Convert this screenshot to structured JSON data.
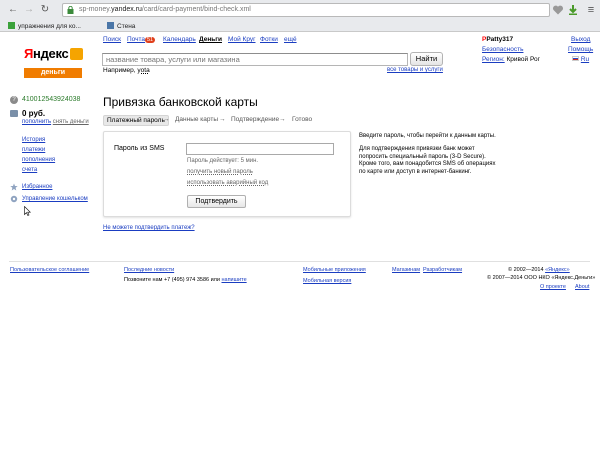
{
  "browser": {
    "url_prefix": "sp-money.",
    "url_domain": "yandex.ru",
    "url_path": "/card/card-payment/bind-check.xml",
    "bookmarks": [
      "упражнения для ко...",
      "Стена"
    ]
  },
  "topnav": {
    "items": [
      "Поиск",
      "Почта",
      "Календарь",
      "Деньги",
      "Мой Круг",
      "Фотки",
      "ещё"
    ],
    "mail_badge": "51",
    "username": "Patty317",
    "right_links": [
      "Безопасность"
    ],
    "region_label": "Регион:",
    "region_value": "Кривой Рог",
    "logout": "Выход",
    "help": "Помощь",
    "lang": "Ru"
  },
  "logo": {
    "text_red": "Я",
    "text_black": "ндекс",
    "sub": "деньги"
  },
  "search": {
    "placeholder": "название товара, услуги или магазина",
    "button": "Найти",
    "example_prefix": "Например,",
    "example_value": "yota",
    "all_link": "все товары и услуги"
  },
  "account": {
    "number": "410012543924038",
    "balance": "0 руб.",
    "topup": "пополнить",
    "withdraw": "снять деньги",
    "menu": [
      "История",
      "платежи",
      "пополнения",
      "счета"
    ],
    "favorites": "Избранное",
    "wallet_settings": "Управление кошельком"
  },
  "page": {
    "title": "Привязка банковской карты",
    "steps": [
      "Платежный пароль",
      "Данные карты",
      "Подтверждение",
      "Готово"
    ],
    "sms_label": "Пароль из SMS",
    "sms_valid": "Пароль действует: 5 мин.",
    "new_password": "получить новый пароль",
    "emergency_code": "использовать аварийный код",
    "confirm_button": "Подтвердить",
    "cant_confirm": "Не можете подтвердить платеж?",
    "info_1": "Введите пароль, чтобы перейти к данным карты.",
    "info_2_lines": [
      "Для подтверждения привязки банк может",
      "попросить специальный пароль (3-D Secure).",
      "Кроме того, вам понадобится SMS об операциях",
      "по карте или доступ в интернет-банкинг."
    ]
  },
  "footer": {
    "agreement": "Пользовательское соглашение",
    "news": "Последние новости",
    "call_prefix": "Позвоните нам +7 (495) 974 3586 или",
    "call_link": "напишите",
    "mobile_apps": "Мобильные приложения",
    "mobile_version": "Мобильная версия",
    "shops": "Магазинам",
    "developers": "Разработчикам",
    "copyright_1_prefix": "© 2002—2014",
    "copyright_1_link": "«Яндекс»",
    "copyright_2": "© 2007—2014 ООО НКО «Яндекс.Деньги»",
    "about_project": "О проекте",
    "about": "About"
  }
}
